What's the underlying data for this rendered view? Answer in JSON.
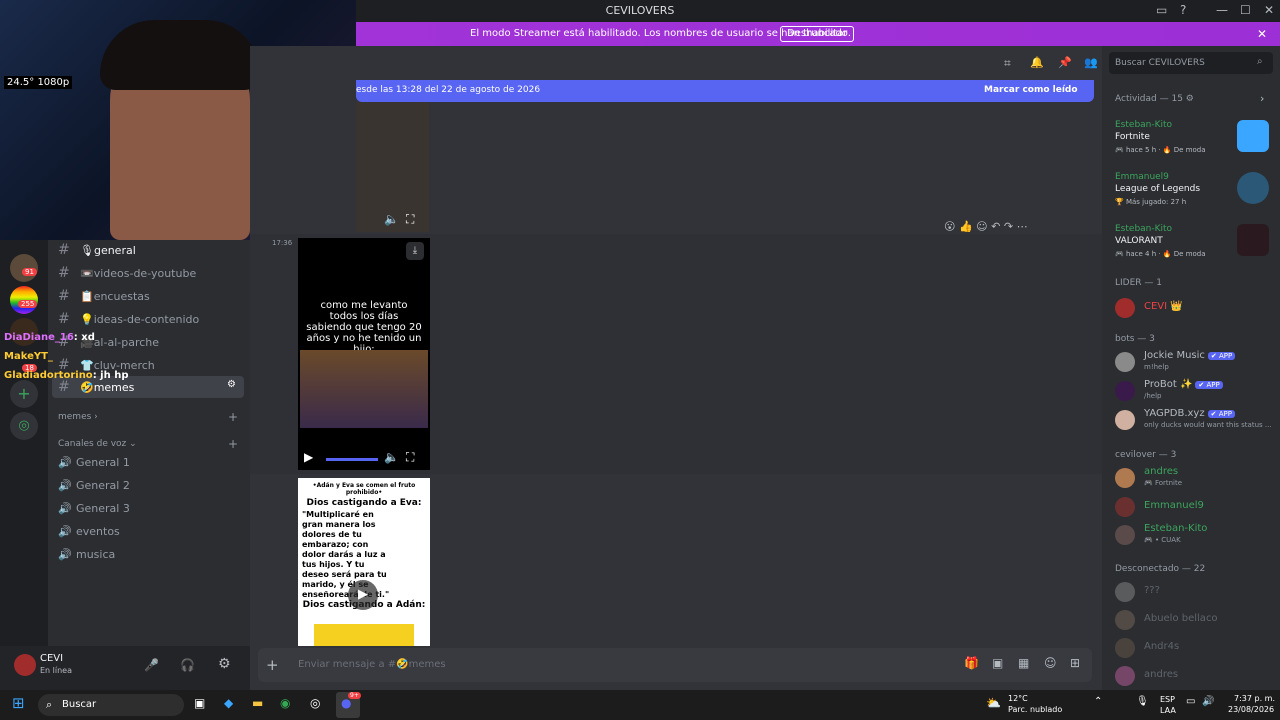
{
  "titlebar": {
    "title": "CEVILOVERS",
    "minimize": "—",
    "maximize": "☐",
    "close": "✕"
  },
  "banner": {
    "message": "El modo Streamer está habilitado. Los nombres de usuario se han truncado.",
    "disable_label": "Deshabilitar",
    "close": "✕"
  },
  "header": {
    "search_placeholder": "Buscar CEVILOVERS"
  },
  "unread_bar": {
    "text": "esde las 13:28 del 22 de agosto de 2026",
    "mark_read": "Marcar como leído"
  },
  "overlay": {
    "chat_lines": [
      {
        "user": "DiaDiane_16",
        "text": ": xd"
      },
      {
        "user": "MakeYT_",
        "text": ""
      },
      {
        "user": "Gladiadortorino",
        "text": ": jh hp"
      }
    ],
    "cam_stats": "24.5° 1080p"
  },
  "guild_badges": [
    "91",
    "255",
    "18"
  ],
  "channels": [
    {
      "name": "🎙general",
      "active": true
    },
    {
      "name": "📼videos-de-youtube",
      "active": false
    },
    {
      "name": "📋encuestas",
      "active": false
    },
    {
      "name": "💡ideas-de-contenido",
      "active": false
    },
    {
      "name": "🎥al-al-parche",
      "active": false
    },
    {
      "name": "👕cluv-merch",
      "active": false
    },
    {
      "name": "🤣memes",
      "active": true
    }
  ],
  "categories": {
    "memes": "memes",
    "voice": "Canales de voz"
  },
  "voice_channels": [
    "General 1",
    "General 2",
    "General 3",
    "eventos",
    "musica"
  ],
  "user": {
    "name": "CEVI",
    "status": "En línea"
  },
  "messages": {
    "timestamp": "17:36",
    "video1": {
      "caption": "como me levanto todos los días sabiendo que tengo 20 años y no he tenido un hijo:"
    },
    "video2": {
      "header": "•Adán y Eva se comen el fruto prohibido•",
      "title1": "Dios castigando a Eva:",
      "quote": "\"Multiplicaré en gran manera los dolores de tu embarazo; con dolor darás a luz a tus hijos. Y tu deseo será para tu marido, y él se enseñoreará de ti.\"",
      "title2": "Dios castigando a Adán:"
    }
  },
  "composer": {
    "placeholder": "Enviar mensaje a #🤣memes"
  },
  "members": {
    "activity_header": "Actividad — 15",
    "activities": [
      {
        "user": "Esteban-Kito",
        "game": "Fortnite",
        "meta": "🎮 hace 5 h · 🔥 De moda",
        "color": "#3aa6ff"
      },
      {
        "user": "Emmanuel9",
        "game": "League of Legends",
        "meta": "🏆 Más jugado: 27 h",
        "color": "#2b5876"
      },
      {
        "user": "Esteban-Kito",
        "game": "VALORANT",
        "meta": "🎮 hace 4 h · 🔥 De moda",
        "color": "#e8445a"
      }
    ],
    "groups": [
      {
        "title": "LIDER — 1",
        "items": [
          {
            "name": "CEVI 👑",
            "status": "",
            "color": "#ed4245",
            "bot": false
          }
        ]
      },
      {
        "title": "bots — 3",
        "items": [
          {
            "name": "Jockie Music",
            "status": "m!help",
            "color": "#b5bac1",
            "bot": true
          },
          {
            "name": "ProBot ✨",
            "status": "/help",
            "color": "#b5bac1",
            "bot": true
          },
          {
            "name": "YAGPDB.xyz",
            "status": "only ducks would want this status ...",
            "color": "#b5bac1",
            "bot": true
          }
        ]
      },
      {
        "title": "cevilover — 3",
        "items": [
          {
            "name": "andres",
            "status": "🎮 Fortnite",
            "color": "#3ba55d",
            "bot": false
          },
          {
            "name": "Emmanuel9",
            "status": "",
            "color": "#3ba55d",
            "bot": false
          },
          {
            "name": "Esteban-Kito",
            "status": "🎮 • CUAK",
            "color": "#3ba55d",
            "bot": false
          }
        ]
      },
      {
        "title": "Desconectado — 22",
        "items": [
          {
            "name": "???",
            "status": "",
            "color": "#6d6f78",
            "bot": false
          },
          {
            "name": "Abuelo bellaco",
            "status": "",
            "color": "#6d6f78",
            "bot": false
          },
          {
            "name": "Andr4s",
            "status": "",
            "color": "#6d6f78",
            "bot": false
          },
          {
            "name": "andres",
            "status": "",
            "color": "#6d6f78",
            "bot": false
          }
        ]
      }
    ],
    "app_badge": "✔ APP"
  },
  "taskbar": {
    "search": "Buscar",
    "weather_temp": "12°C",
    "weather_desc": "Parc. nublado",
    "lang1": "ESP",
    "lang2": "LAA",
    "time": "7:37 p. m.",
    "date": "23/08/2026",
    "discord_badge": "9+"
  }
}
